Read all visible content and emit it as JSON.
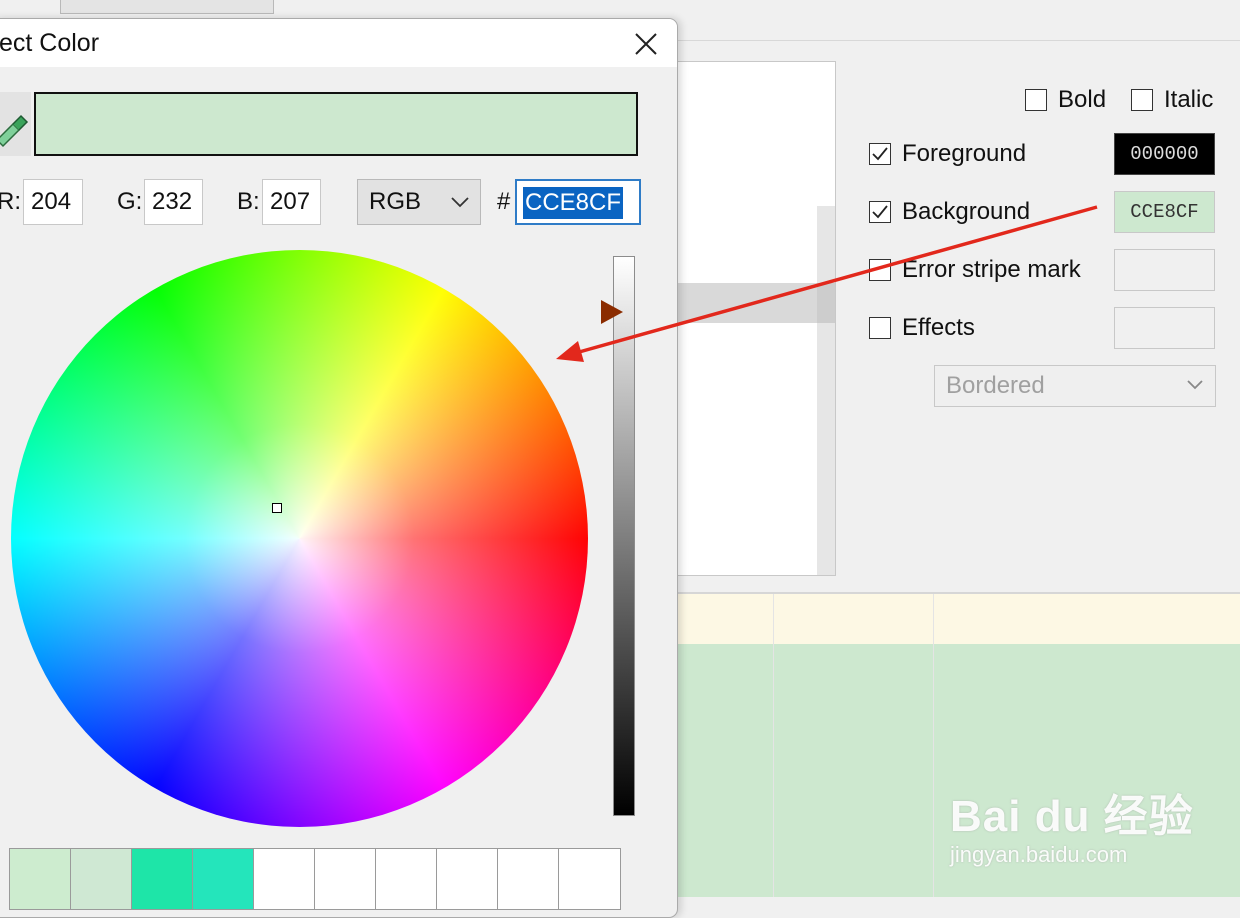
{
  "dialog": {
    "title": "ect Color",
    "preview_color": "#cde8cf",
    "r_label": "R:",
    "r_value": "204",
    "g_label": "G:",
    "g_value": "232",
    "b_label": "B:",
    "b_value": "207",
    "mode": "RGB",
    "hash_label": "#",
    "hex_value": "CCE8CF",
    "brightness_level": 0.9,
    "recent_colors": [
      "#cdeccf",
      "#cfe8d3",
      "#1ee5a8",
      "#24e5bb",
      "#ffffff",
      "#ffffff",
      "#ffffff",
      "#ffffff",
      "#ffffff",
      "#ffffff"
    ]
  },
  "options": {
    "bold_label": "Bold",
    "italic_label": "Italic",
    "foreground_label": "Foreground",
    "foreground_value": "000000",
    "background_label": "Background",
    "background_value": "CCE8CF",
    "error_stripe_label": "Error stripe mark",
    "effects_label": "Effects",
    "effect_type": "Bordered"
  },
  "watermark": {
    "main": "Bai du 经验",
    "sub": "jingyan.baidu.com"
  },
  "colors": {
    "annotation_arrow": "#e2281c",
    "selection_blue": "#0a64c2",
    "pointer": "#8b2c00"
  }
}
